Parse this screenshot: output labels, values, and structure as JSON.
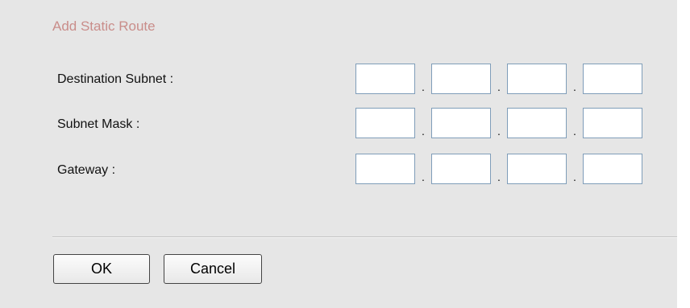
{
  "dialog": {
    "title": "Add Static Route"
  },
  "fields": [
    {
      "label": "Destination Subnet :",
      "octets": [
        "",
        "",
        "",
        ""
      ],
      "separator": "."
    },
    {
      "label": "Subnet Mask :",
      "octets": [
        "",
        "",
        "",
        ""
      ],
      "separator": "."
    },
    {
      "label": "Gateway :",
      "octets": [
        "",
        "",
        "",
        ""
      ],
      "separator": "."
    }
  ],
  "buttons": {
    "ok_label": "OK",
    "cancel_label": "Cancel"
  }
}
